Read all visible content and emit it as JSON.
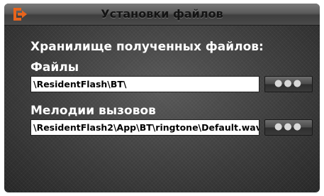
{
  "window": {
    "title": "Установки файлов",
    "back_icon": "exit-icon",
    "accent_color": "#e8641c"
  },
  "storage": {
    "heading": "Хранилище полученных файлов:",
    "files": {
      "label": "Файлы",
      "value": "\\ResidentFlash\\BT\\",
      "browse_label": "●●●"
    },
    "ringtones": {
      "label": "Мелодии вызовов",
      "value": "\\ResidentFlash2\\App\\BT\\ringtone\\Default.wav",
      "browse_label": "●●●"
    }
  }
}
